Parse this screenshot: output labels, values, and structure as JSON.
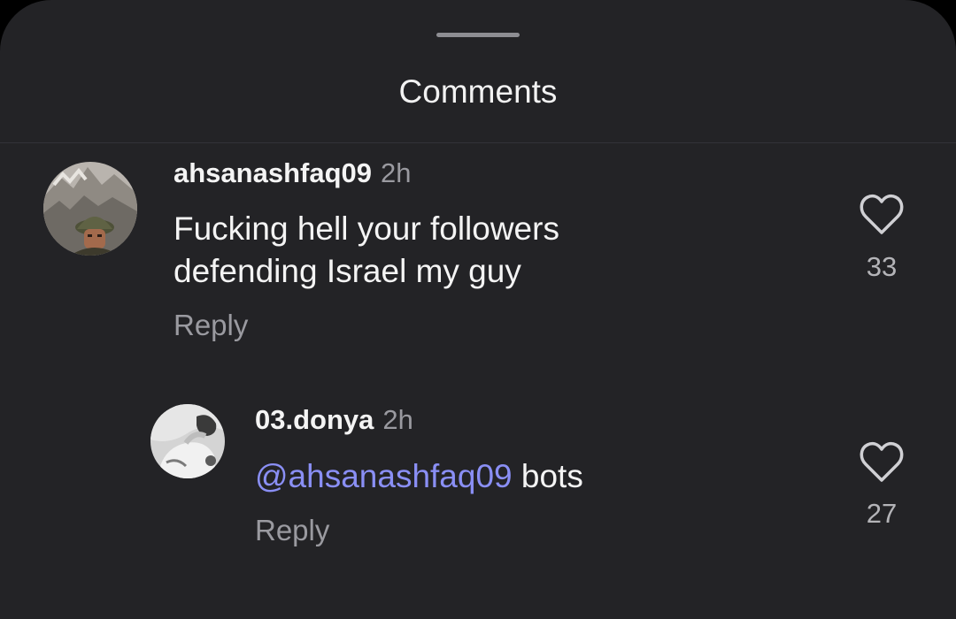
{
  "sheet": {
    "title": "Comments"
  },
  "comments": [
    {
      "username": "ahsanashfaq09",
      "time": "2h",
      "text_line1": "Fucking hell your followers",
      "text_line2": "defending Israel my guy",
      "reply_label": "Reply",
      "likes": "33",
      "avatar_icon": "avatar-soldier-helmet"
    },
    {
      "username": "03.donya",
      "time": "2h",
      "mention": "@ahsanashfaq09",
      "text": " bots",
      "reply_label": "Reply",
      "likes": "27",
      "avatar_icon": "avatar-person-grayscale"
    }
  ],
  "colors": {
    "sheet_background": "#232326",
    "mention": "#8a8ff5",
    "secondary_text": "#9a9aa0"
  }
}
